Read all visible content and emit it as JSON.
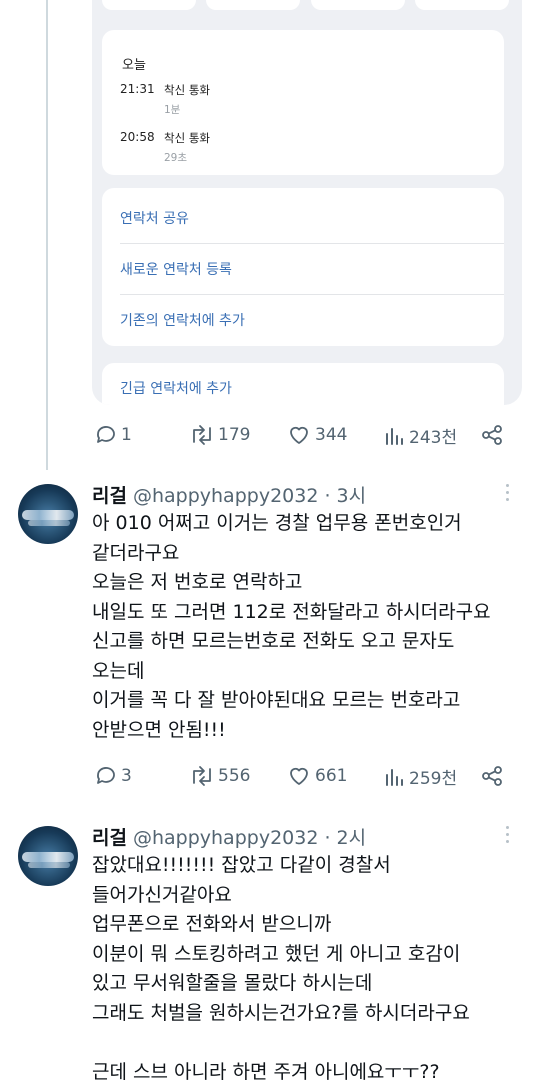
{
  "embedded_screenshot": {
    "calls": {
      "section_title": "오늘",
      "items": [
        {
          "time": "21:31",
          "type": "착신 통화",
          "duration": "1분"
        },
        {
          "time": "20:58",
          "type": "착신 통화",
          "duration": "29초"
        }
      ]
    },
    "actions": [
      "연락처 공유",
      "새로운 연락처 등록",
      "기존의 연락처에 추가"
    ],
    "emergency_action": "긴급 연락처에 추가"
  },
  "first_tweet_stats": {
    "replies": "1",
    "retweets": "179",
    "likes": "344",
    "views": "243천"
  },
  "tweets": [
    {
      "name": "리걸",
      "handle": "@happyhappy2032 · 3시",
      "lines": [
        "아 010 어쩌고 이거는 경찰 업무용 폰번호인거",
        "같더라구요",
        "오늘은 저 번호로 연락하고",
        "내일도 또 그러면 112로 전화달라고 하시더라구요",
        "신고를 하면 모르는번호로 전화도 오고 문자도",
        "오는데",
        "이거를 꼭 다 잘 받아야된대요 모르는 번호라고",
        "안받으면 안됨!!!"
      ],
      "stats": {
        "replies": "3",
        "retweets": "556",
        "likes": "661",
        "views": "259천"
      }
    },
    {
      "name": "리걸",
      "handle": "@happyhappy2032 · 2시",
      "lines": [
        "잡았대요!!!!!!! 잡았고 다같이 경찰서",
        "들어가신거같아요",
        "업무폰으로 전화와서 받으니까",
        "이분이 뭐 스토킹하려고 했던 게 아니고 호감이",
        "있고 무서워할줄을 몰랐다 하시는데",
        "그래도 처벌을 원하시는건가요?를 하시더라구요",
        "",
        "근데 스브 아니라 하면 주겨 아니에요ㅜㅜ??"
      ]
    }
  ]
}
